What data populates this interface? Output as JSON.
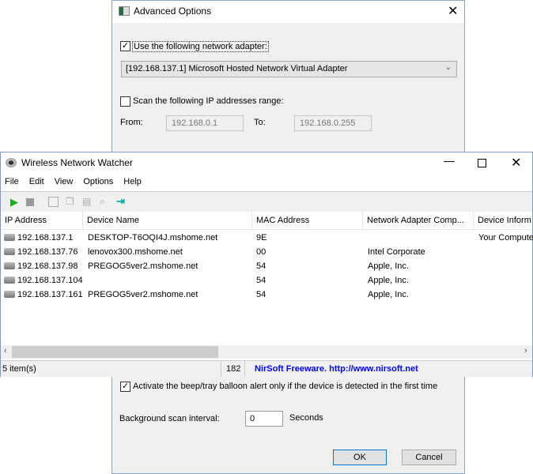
{
  "dialog": {
    "title": "Advanced Options",
    "use_adapter_label": "Use the following network adapter:",
    "use_adapter_checked": true,
    "adapter_value": "[192.168.137.1]  Microsoft Hosted Network Virtual Adapter",
    "scan_range_label": "Scan the following IP addresses range:",
    "scan_range_checked": false,
    "from_label": "From:",
    "from_value": "192.168.0.1",
    "to_label": "To:",
    "to_value": "192.168.0.255",
    "beep_label": "Activate the beep/tray balloon alert only if the device is detected in the first time",
    "beep_checked": true,
    "interval_label": "Background scan interval:",
    "interval_value": "0",
    "interval_unit": "Seconds",
    "ok": "OK",
    "cancel": "Cancel"
  },
  "main": {
    "title": "Wireless Network Watcher",
    "menu": [
      "File",
      "Edit",
      "View",
      "Options",
      "Help"
    ],
    "columns": [
      "IP Address",
      "Device Name",
      "MAC Address",
      "Network Adapter Comp...",
      "Device Inform"
    ],
    "rows": [
      [
        "192.168.137.1",
        "DESKTOP-T6OQI4J.mshome.net",
        "9E",
        "",
        "Your Compute"
      ],
      [
        "192.168.137.76",
        "lenovox300.mshome.net",
        "00",
        "Intel Corporate",
        ""
      ],
      [
        "192.168.137.98",
        "PREGOG5ver2.mshome.net",
        "54",
        "Apple, Inc.",
        ""
      ],
      [
        "192.168.137.104",
        "",
        "54",
        "Apple, Inc.",
        ""
      ],
      [
        "192.168.137.161",
        "PREGOG5ver2.mshome.net",
        "54",
        "Apple, Inc.",
        ""
      ]
    ],
    "status": {
      "items": "5 item(s)",
      "count": "182",
      "link": "NirSoft Freeware.  http://www.nirsoft.net"
    },
    "link_color": "#0000ff"
  }
}
